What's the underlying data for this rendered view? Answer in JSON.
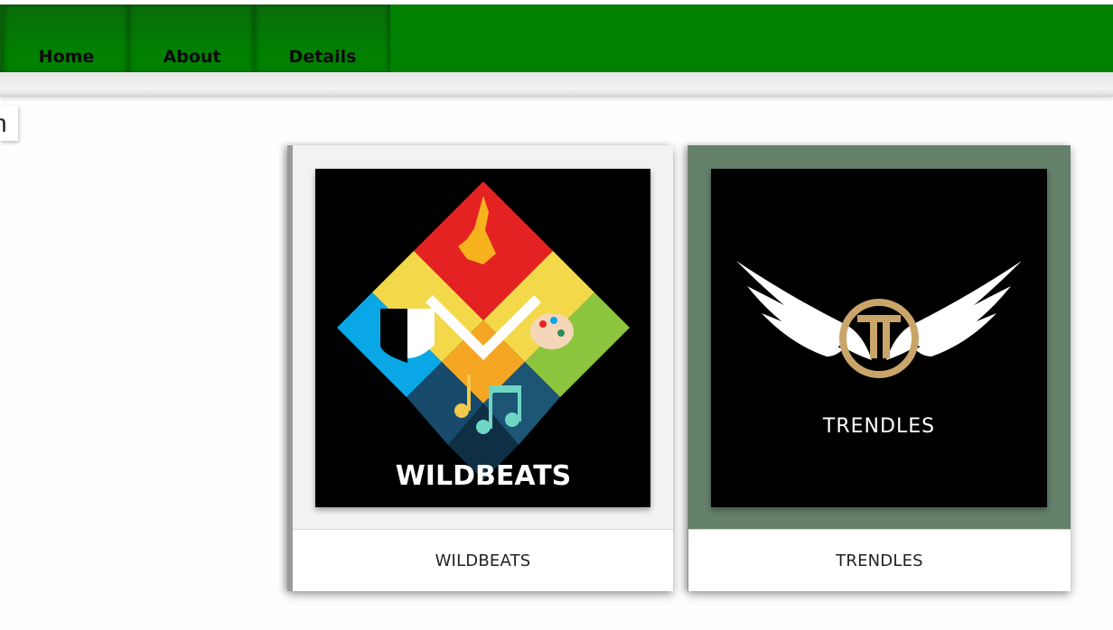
{
  "nav": {
    "items": [
      {
        "label": "Home"
      },
      {
        "label": "About"
      },
      {
        "label": "Details"
      }
    ],
    "bar_color": "#018001"
  },
  "left_tab": {
    "text": "n"
  },
  "cards": [
    {
      "logo_text": "WILDBEATS",
      "caption": "WILDBEATS",
      "background": "#f2f2f2"
    },
    {
      "logo_text": "TRENDLES",
      "caption": "TRENDLES",
      "background": "#64816a"
    }
  ]
}
